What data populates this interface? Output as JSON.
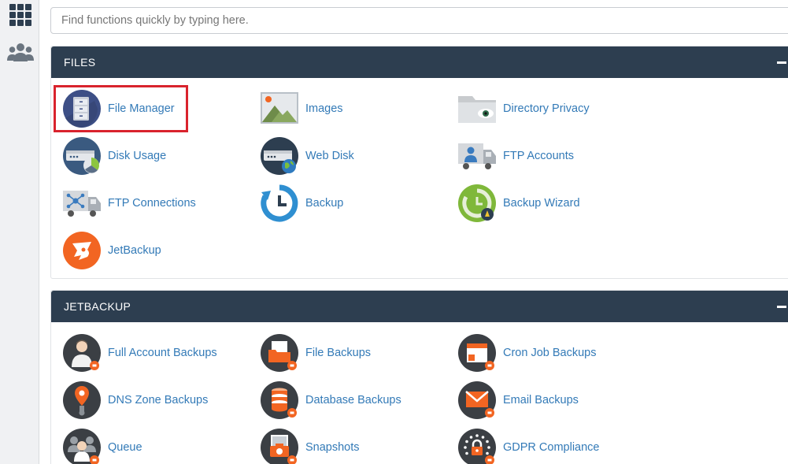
{
  "search": {
    "placeholder": "Find functions quickly by typing here."
  },
  "sidebar": {
    "grid_icon": "grid-icon",
    "users_icon": "users-icon"
  },
  "files": {
    "title": "FILES",
    "items": [
      {
        "label": "File Manager",
        "icon": "file-manager-icon"
      },
      {
        "label": "Images",
        "icon": "images-icon"
      },
      {
        "label": "Directory Privacy",
        "icon": "directory-privacy-icon"
      },
      {
        "label": "Disk Usage",
        "icon": "disk-usage-icon"
      },
      {
        "label": "Web Disk",
        "icon": "web-disk-icon"
      },
      {
        "label": "FTP Accounts",
        "icon": "ftp-accounts-icon"
      },
      {
        "label": "FTP Connections",
        "icon": "ftp-connections-icon"
      },
      {
        "label": "Backup",
        "icon": "backup-icon"
      },
      {
        "label": "Backup Wizard",
        "icon": "backup-wizard-icon"
      },
      {
        "label": "JetBackup",
        "icon": "jetbackup-icon"
      }
    ]
  },
  "jetbackup": {
    "title": "JETBACKUP",
    "items": [
      {
        "label": "Full Account Backups",
        "icon": "full-account-backups-icon"
      },
      {
        "label": "File Backups",
        "icon": "file-backups-icon"
      },
      {
        "label": "Cron Job Backups",
        "icon": "cron-job-backups-icon"
      },
      {
        "label": "DNS Zone Backups",
        "icon": "dns-zone-backups-icon"
      },
      {
        "label": "Database Backups",
        "icon": "database-backups-icon"
      },
      {
        "label": "Email Backups",
        "icon": "email-backups-icon"
      },
      {
        "label": "Queue",
        "icon": "queue-icon"
      },
      {
        "label": "Snapshots",
        "icon": "snapshots-icon"
      },
      {
        "label": "GDPR Compliance",
        "icon": "gdpr-compliance-icon"
      }
    ]
  },
  "colors": {
    "header": "#2d3e50",
    "link": "#337ab7",
    "highlight": "#d9232d",
    "accent_orange": "#f26522"
  }
}
